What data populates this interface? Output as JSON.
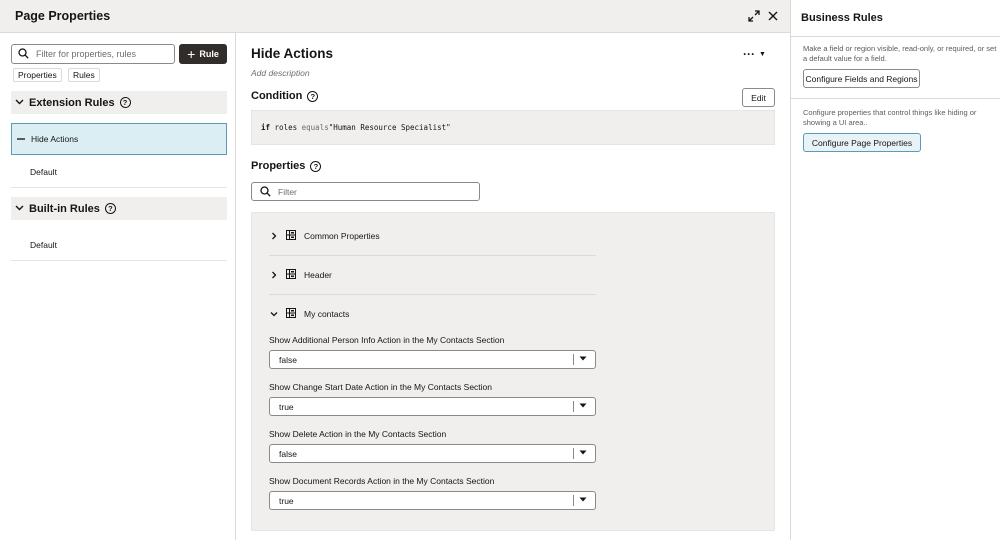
{
  "left_panel": {
    "title": "Page Properties",
    "icons": {
      "expand": "expand-icon",
      "close": "close-icon"
    }
  },
  "sidebar": {
    "search": {
      "placeholder": "Filter for properties, rules",
      "value": ""
    },
    "rule_button_label": "Rule",
    "chips": [
      "Properties",
      "Rules"
    ],
    "extension_rules": {
      "label": "Extension Rules",
      "items": [
        "Hide Actions",
        "Default"
      ],
      "selected": "Hide Actions"
    },
    "builtin_rules": {
      "label": "Built-in Rules",
      "items": [
        "Default"
      ]
    }
  },
  "main": {
    "title": "Hide Actions",
    "description": "Add description",
    "condition": {
      "label": "Condition",
      "edit_label": "Edit",
      "keyword": "if",
      "field": "roles",
      "operator": "equals",
      "value": "\"Human Resource Specialist\""
    },
    "properties": {
      "label": "Properties",
      "filter_placeholder": "Filter",
      "groups": [
        {
          "label": "Common Properties",
          "expanded": false
        },
        {
          "label": "Header",
          "expanded": false
        },
        {
          "label": "My contacts",
          "expanded": true
        }
      ],
      "fields": [
        {
          "label": "Show Additional Person Info Action in the My Contacts Section",
          "value": "false"
        },
        {
          "label": "Show Change Start Date Action in the My Contacts Section",
          "value": "true"
        },
        {
          "label": "Show Delete Action in the My Contacts Section",
          "value": "false"
        },
        {
          "label": "Show Document Records Action in the My Contacts Section",
          "value": "true"
        }
      ]
    }
  },
  "right_panel": {
    "title": "Business Rules",
    "text1": "Make a field or region visible, read-only, or required, or set a default value for a field.",
    "button1": "Configure Fields and Regions",
    "text2": "Configure properties that control things like hiding or showing a UI area..",
    "button2": "Configure Page Properties"
  },
  "colors": {
    "header_bg": "#f1efed",
    "primary_button": "#312d2a",
    "selected_bg": "#daeef4",
    "selected_border": "#5b9bb5"
  }
}
